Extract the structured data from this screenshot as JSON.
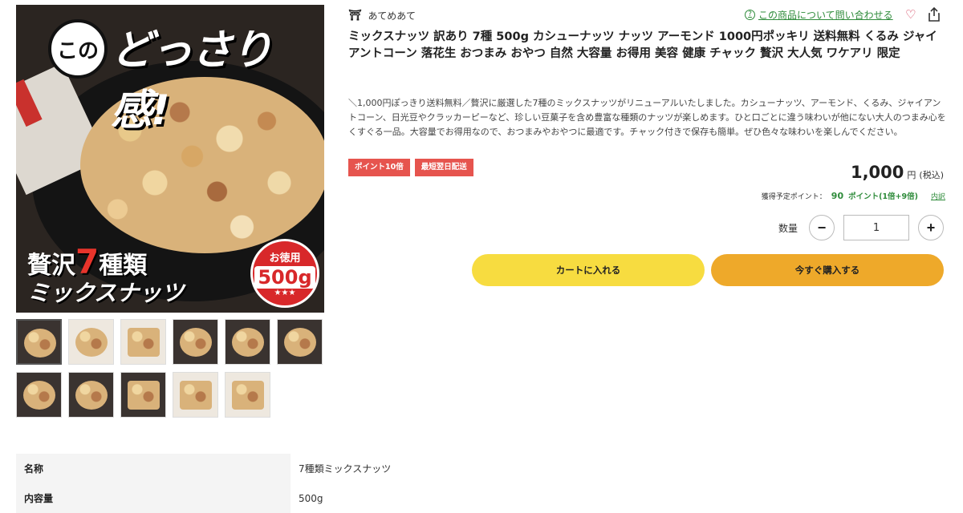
{
  "main_image": {
    "kono": "この",
    "headline": "どっさり感!",
    "zeitaku": "贅沢",
    "seven": "7",
    "shurui": "種類",
    "mix": "ミックスナッツ",
    "badge_top": "お徳用",
    "badge_weight": "500g",
    "badge_stars": "★★★"
  },
  "shop": {
    "name": "あてめあて"
  },
  "inquiry": {
    "label": "この商品について問い合わせる"
  },
  "product": {
    "title": "ミックスナッツ 訳あり 7種 500g カシューナッツ ナッツ アーモンド 1000円ポッキリ 送料無料 くるみ ジャイアントコーン 落花生 おつまみ おやつ 自然 大容量 お得用 美容 健康 チャック 贅沢 大人気 ワケアリ 限定",
    "description": "＼1,000円ぽっきり送料無料／贅沢に厳選した7種のミックスナッツがリニューアルいたしました。カシューナッツ、アーモンド、くるみ、ジャイアントコーン、日光豆やクラッカーピーなど、珍しい豆菓子を含め豊富な種類のナッツが楽しめます。ひと口ごとに違う味わいが他にない大人のつまみ心をくすぐる一品。大容量でお得用なので、おつまみやおやつに最適です。チャック付きで保存も簡単。ぜひ色々な味わいを楽しんでください。",
    "tags": [
      "ポイント10倍",
      "最短翌日配送"
    ]
  },
  "price": {
    "amount": "1,000",
    "yen": "円",
    "tax": "(税込)"
  },
  "points": {
    "label": "獲得予定ポイント：",
    "value": "90",
    "unit": "ポイント(1倍+9倍)",
    "detail": "内訳"
  },
  "quantity": {
    "label": "数量",
    "value": "1",
    "minus": "−",
    "plus": "+"
  },
  "buttons": {
    "cart": "カートに入れる",
    "buy": "今すぐ購入する"
  },
  "spec": [
    {
      "key": "名称",
      "value": "7種類ミックスナッツ"
    },
    {
      "key": "内容量",
      "value": "500g"
    }
  ]
}
